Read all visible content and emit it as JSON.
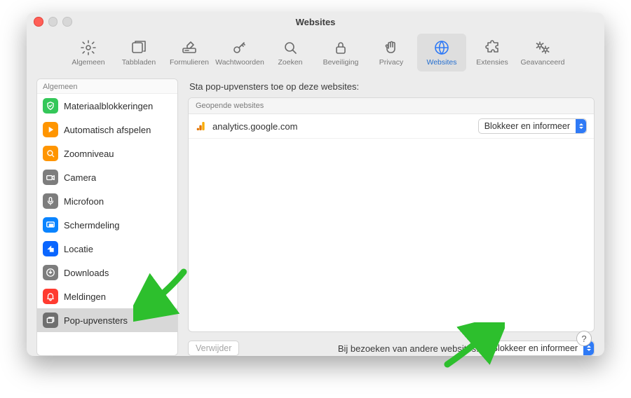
{
  "window": {
    "title": "Websites"
  },
  "tabs": [
    {
      "id": "algemeen",
      "label": "Algemeen",
      "icon": "gear"
    },
    {
      "id": "tabbladen",
      "label": "Tabbladen",
      "icon": "tabs"
    },
    {
      "id": "formulieren",
      "label": "Formulieren",
      "icon": "pen-field"
    },
    {
      "id": "wachtwoorden",
      "label": "Wachtwoorden",
      "icon": "key"
    },
    {
      "id": "zoeken",
      "label": "Zoeken",
      "icon": "magnifier"
    },
    {
      "id": "beveiliging",
      "label": "Beveiliging",
      "icon": "lock"
    },
    {
      "id": "privacy",
      "label": "Privacy",
      "icon": "hand"
    },
    {
      "id": "websites",
      "label": "Websites",
      "icon": "globe",
      "active": true
    },
    {
      "id": "extensies",
      "label": "Extensies",
      "icon": "puzzle"
    },
    {
      "id": "geavanceerd",
      "label": "Geavanceerd",
      "icon": "gears"
    }
  ],
  "sidebar": {
    "heading": "Algemeen",
    "items": [
      {
        "label": "Materiaalblokkeringen",
        "icon": "shield-check",
        "color": "#34c759"
      },
      {
        "label": "Automatisch afspelen",
        "icon": "play",
        "color": "#ff9500"
      },
      {
        "label": "Zoomniveau",
        "icon": "zoom",
        "color": "#ff9500"
      },
      {
        "label": "Camera",
        "icon": "camera",
        "color": "#7d7d7d"
      },
      {
        "label": "Microfoon",
        "icon": "mic",
        "color": "#7d7d7d"
      },
      {
        "label": "Schermdeling",
        "icon": "screen-share",
        "color": "#0a84ff"
      },
      {
        "label": "Locatie",
        "icon": "arrow-compass",
        "color": "#0a66ff"
      },
      {
        "label": "Downloads",
        "icon": "download",
        "color": "#7d7d7d"
      },
      {
        "label": "Meldingen",
        "icon": "bell",
        "color": "#ff3b30"
      },
      {
        "label": "Pop-upvensters",
        "icon": "popup-windows",
        "color": "#6f6f6f",
        "selected": true
      }
    ]
  },
  "content": {
    "heading": "Sta pop-upvensters toe op deze websites:",
    "table_heading": "Geopende websites",
    "rows": [
      {
        "site": "analytics.google.com",
        "favicon": "ga",
        "value": "Blokkeer en informeer"
      }
    ]
  },
  "footer": {
    "delete_label": "Verwijder",
    "others_label": "Bij bezoeken van andere websites:",
    "others_value": "Blokkeer en informeer"
  },
  "accent": "#2f7af6",
  "arrow_color": "#2dbf2d"
}
